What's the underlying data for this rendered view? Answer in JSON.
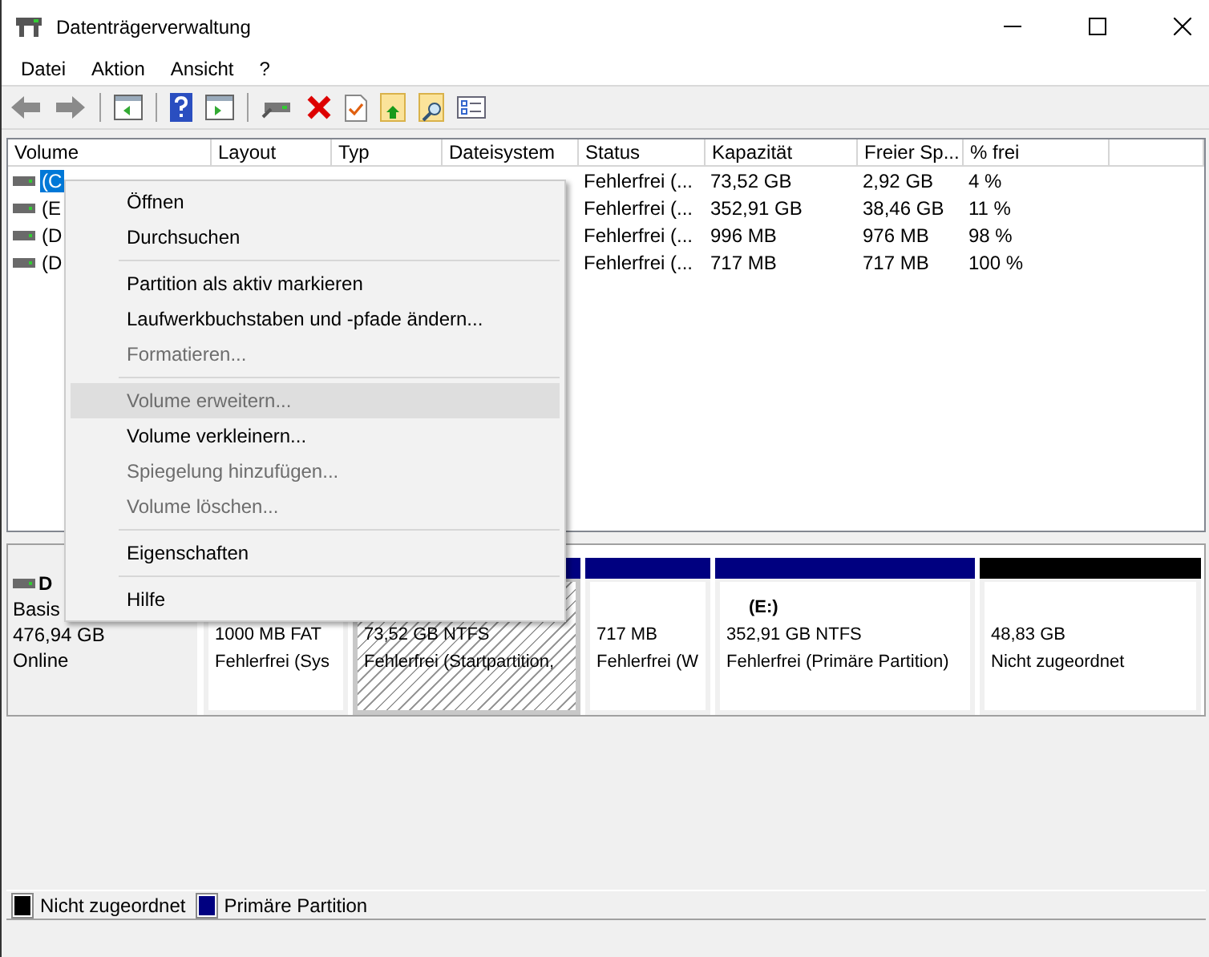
{
  "window": {
    "title": "Datenträgerverwaltung"
  },
  "menu_bar": [
    "Datei",
    "Aktion",
    "Ansicht",
    "?"
  ],
  "table": {
    "columns": [
      "Volume",
      "Layout",
      "Typ",
      "Dateisystem",
      "Status",
      "Kapazität",
      "Freier Sp...",
      "% frei"
    ],
    "rows": [
      {
        "volume": "(C",
        "selected": true,
        "status": "Fehlerfrei (...",
        "capacity": "73,52 GB",
        "free": "2,92 GB",
        "percent_free": "4 %"
      },
      {
        "volume": "(E",
        "selected": false,
        "status": "Fehlerfrei (...",
        "capacity": "352,91 GB",
        "free": "38,46 GB",
        "percent_free": "11 %"
      },
      {
        "volume": "(D",
        "selected": false,
        "status": "Fehlerfrei (...",
        "capacity": "996 MB",
        "free": "976 MB",
        "percent_free": "98 %"
      },
      {
        "volume": "(D",
        "selected": false,
        "status": "Fehlerfrei (...",
        "capacity": "717 MB",
        "free": "717 MB",
        "percent_free": "100 %"
      }
    ]
  },
  "context_menu": [
    {
      "kind": "item",
      "label": "Öffnen",
      "disabled": false,
      "highlighted": false
    },
    {
      "kind": "item",
      "label": "Durchsuchen",
      "disabled": false,
      "highlighted": false
    },
    {
      "kind": "separator"
    },
    {
      "kind": "item",
      "label": "Partition als aktiv markieren",
      "disabled": false,
      "highlighted": false
    },
    {
      "kind": "item",
      "label": "Laufwerkbuchstaben und -pfade ändern...",
      "disabled": false,
      "highlighted": false
    },
    {
      "kind": "item",
      "label": "Formatieren...",
      "disabled": true,
      "highlighted": false
    },
    {
      "kind": "separator"
    },
    {
      "kind": "item",
      "label": "Volume erweitern...",
      "disabled": true,
      "highlighted": true
    },
    {
      "kind": "item",
      "label": "Volume verkleinern...",
      "disabled": false,
      "highlighted": false
    },
    {
      "kind": "item",
      "label": "Spiegelung hinzufügen...",
      "disabled": true,
      "highlighted": false
    },
    {
      "kind": "item",
      "label": "Volume löschen...",
      "disabled": true,
      "highlighted": false
    },
    {
      "kind": "separator"
    },
    {
      "kind": "item",
      "label": "Eigenschaften",
      "disabled": false,
      "highlighted": false
    },
    {
      "kind": "separator"
    },
    {
      "kind": "item",
      "label": "Hilfe",
      "disabled": false,
      "highlighted": false
    }
  ],
  "disk": {
    "name": "D",
    "type": "Basis",
    "size": "476,94 GB",
    "status": "Online",
    "partitions": [
      {
        "selected": false,
        "size": "1000 MB FAT",
        "status": "Fehlerfrei (Sys"
      },
      {
        "color": "#000080",
        "selected": true,
        "size": "73,52 GB NTFS",
        "status": "Fehlerfrei (Startpartition,"
      },
      {
        "color": "#000080",
        "selected": false,
        "size": "717 MB",
        "status": "Fehlerfrei (W"
      },
      {
        "color": "#000080",
        "selected": false,
        "label": "(E:)",
        "size": "352,91 GB NTFS",
        "status": "Fehlerfrei (Primäre Partition)"
      },
      {
        "color": "#000000",
        "selected": false,
        "size": "48,83 GB",
        "status": "Nicht zugeordnet"
      }
    ]
  },
  "legend": [
    {
      "color": "#000000",
      "label": "Nicht zugeordnet"
    },
    {
      "color": "#000080",
      "label": "Primäre Partition"
    }
  ]
}
